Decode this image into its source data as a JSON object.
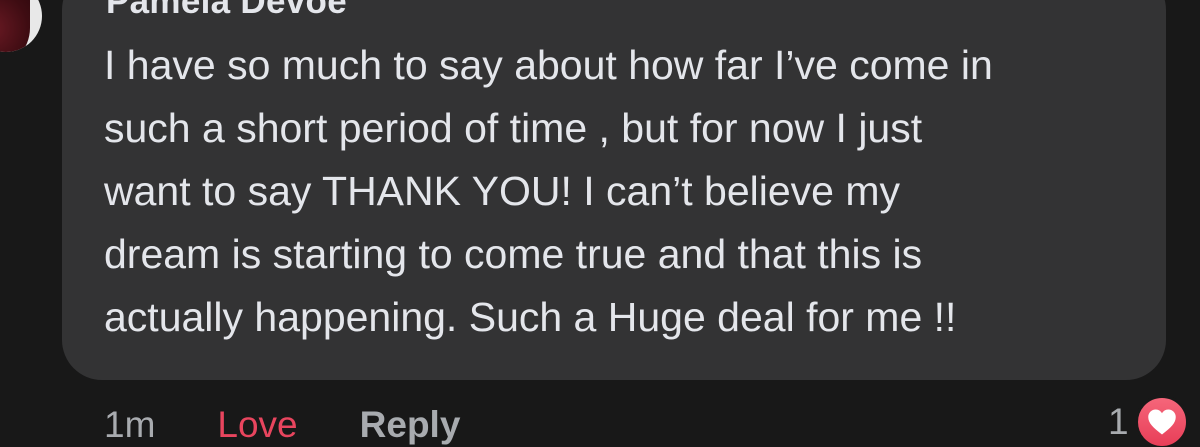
{
  "comment": {
    "author": "Pamela Devoe",
    "lines": [
      "I have so much to say about how far I’ve come in",
      "such a short period of time , but for now I just",
      "want to say THANK YOU! I can’t believe my",
      "dream is starting to come true and that this is",
      "actually happening. Such a Huge deal for me !!"
    ]
  },
  "actions": {
    "time": "1m",
    "love_label": "Love",
    "reply_label": "Reply"
  },
  "reactions": {
    "count": "1",
    "icon": "heart-icon"
  },
  "colors": {
    "background": "#181818",
    "bubble": "#333334",
    "text": "#e4e6eb",
    "muted": "#a8abaf",
    "love": "#e8455e"
  }
}
